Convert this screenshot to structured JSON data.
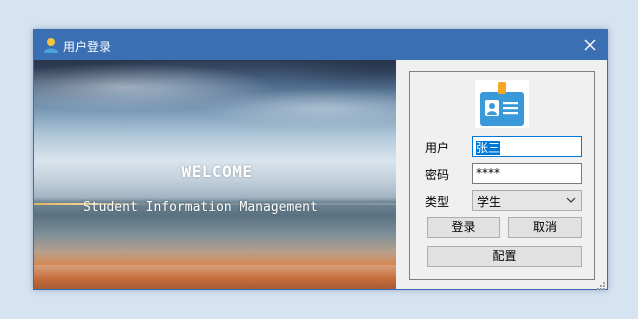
{
  "window": {
    "title": "用户登录",
    "close_glyph": "×"
  },
  "banner": {
    "welcome": "WELCOME",
    "subtitle": "Student Information Management"
  },
  "form": {
    "user_label": "用户",
    "user_value": "张三",
    "password_label": "密码",
    "password_value": "****",
    "type_label": "类型",
    "type_value": "学生",
    "login_button": "登录",
    "cancel_button": "取消",
    "config_button": "配置"
  },
  "colors": {
    "titlebar": "#3b6fb4",
    "selection": "#0078d7",
    "badge_blue": "#3a9ad9",
    "badge_clip": "#f5a623"
  },
  "icons": {
    "title": "user-icon",
    "close": "close-icon",
    "badge": "id-badge-icon",
    "dropdown": "chevron-down-icon"
  }
}
